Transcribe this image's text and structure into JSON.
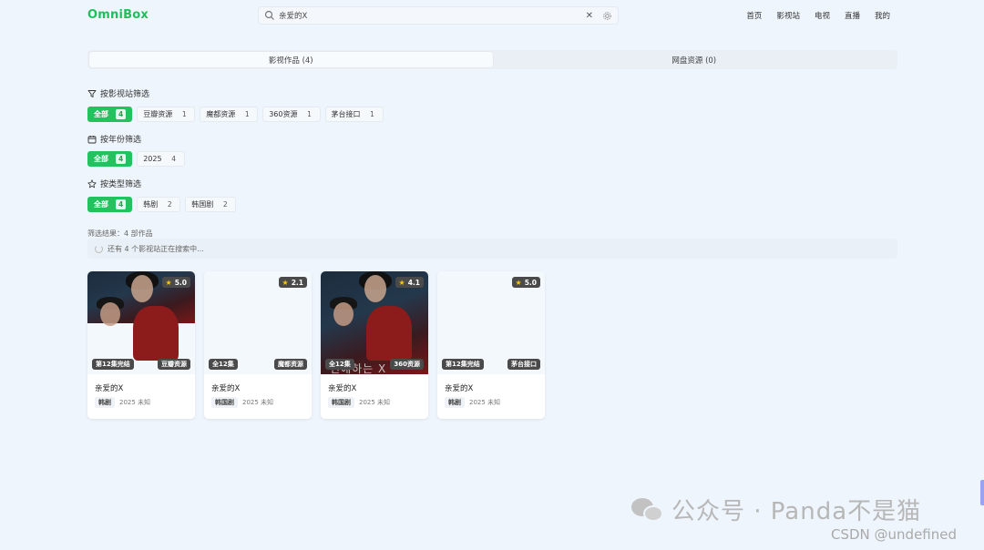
{
  "header": {
    "logo": "OmniBox",
    "search_value": "亲爱的X",
    "clear_glyph": "✕",
    "nav": [
      "首页",
      "影视站",
      "电视",
      "直播",
      "我的"
    ]
  },
  "tabs": [
    {
      "label": "影视作品 (4)",
      "active": true
    },
    {
      "label": "网盘资源 (0)",
      "active": false
    }
  ],
  "filters": {
    "site": {
      "title": "按影视站筛选",
      "icon": "filter-icon",
      "chips": [
        {
          "label": "全部",
          "count": "4",
          "active": true
        },
        {
          "label": "豆瓣资源",
          "count": "1"
        },
        {
          "label": "魔都资源",
          "count": "1"
        },
        {
          "label": "360资源",
          "count": "1"
        },
        {
          "label": "茅台接口",
          "count": "1"
        }
      ]
    },
    "year": {
      "title": "按年份筛选",
      "icon": "calendar-icon",
      "chips": [
        {
          "label": "全部",
          "count": "4",
          "active": true
        },
        {
          "label": "2025",
          "count": "4"
        }
      ]
    },
    "type": {
      "title": "按类型筛选",
      "icon": "star-outline-icon",
      "chips": [
        {
          "label": "全部",
          "count": "4",
          "active": true
        },
        {
          "label": "韩剧",
          "count": "2"
        },
        {
          "label": "韩国剧",
          "count": "2"
        }
      ]
    }
  },
  "result_text": "筛选结果：4 部作品",
  "loading_text": "还有 4 个影视站正在搜索中...",
  "cards": [
    {
      "rating": "5.0",
      "episodes": "第12集完结",
      "source": "豆瓣资源",
      "title": "亲爱的X",
      "genre": "韩剧",
      "year_area": "2025 未知",
      "poster": "short"
    },
    {
      "rating": "2.1",
      "episodes": "全12集",
      "source": "魔都资源",
      "title": "亲爱的X",
      "genre": "韩国剧",
      "year_area": "2025 未知",
      "poster": "none"
    },
    {
      "rating": "4.1",
      "episodes": "全12集",
      "source": "360资源",
      "title": "亲爱的X",
      "genre": "韩国剧",
      "year_area": "2025 未知",
      "poster": "full",
      "poster_text": "친애하는 X"
    },
    {
      "rating": "5.0",
      "episodes": "第12集完结",
      "source": "茅台接口",
      "title": "亲爱的X",
      "genre": "韩剧",
      "year_area": "2025 未知",
      "poster": "none"
    }
  ],
  "watermark": {
    "line1": "公众号 · Panda不是猫",
    "line2": "CSDN @undefined"
  },
  "colors": {
    "accent": "#22c35e",
    "logo": "#1fbf5c",
    "badge": "#4a4a4a",
    "star": "#f5c518"
  }
}
